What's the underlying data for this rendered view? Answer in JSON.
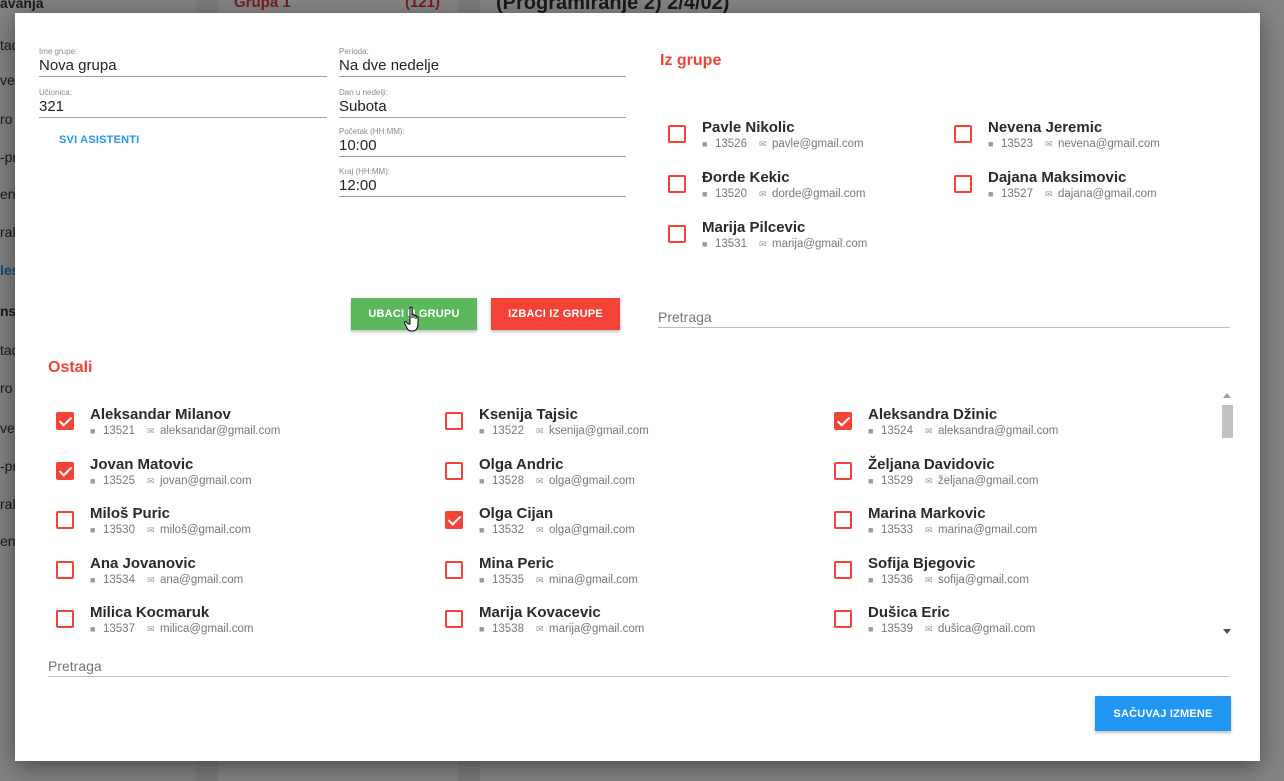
{
  "background": {
    "sidebar_items": [
      {
        "text": "avanja",
        "style": "bold"
      },
      {
        "text": "tad",
        "style": ""
      },
      {
        "text": "ve",
        "style": ""
      },
      {
        "text": "ro",
        "style": ""
      },
      {
        "text": "-pr",
        "style": ""
      },
      {
        "text": "en",
        "style": ""
      },
      {
        "text": "ral",
        "style": ""
      },
      {
        "text": "les",
        "style": "blue"
      },
      {
        "text": "ns",
        "style": "bold"
      },
      {
        "text": "tad",
        "style": ""
      },
      {
        "text": "ro",
        "style": ""
      },
      {
        "text": "ve",
        "style": ""
      },
      {
        "text": "-pr",
        "style": ""
      },
      {
        "text": "ral",
        "style": ""
      },
      {
        "text": "en",
        "style": ""
      }
    ],
    "group_name": "Grupa 1",
    "group_count": "(121)",
    "main_heading": "(Programiranje 2) 2/4/02)"
  },
  "form": {
    "group_name_label": "Ime grupe:",
    "group_name_value": "Nova grupa",
    "classroom_label": "Učionica:",
    "classroom_value": "321",
    "all_assistants_label": "SVI ASISTENTI",
    "period_label": "Perioda:",
    "period_value": "Na dve nedelje",
    "weekday_label": "Dan u nedelji:",
    "weekday_value": "Subota",
    "start_label": "Početak (HH:MM):",
    "start_value": "10:00",
    "end_label": "Kraj (HH:MM):",
    "end_value": "12:00"
  },
  "in_group": {
    "title": "Iz grupe",
    "search_placeholder": "Pretraga",
    "members": [
      {
        "name": "Pavle Nikolic",
        "id": "13526",
        "email": "pavle@gmail.com",
        "checked": false
      },
      {
        "name": "Nevena Jeremic",
        "id": "13523",
        "email": "nevena@gmail.com",
        "checked": false
      },
      {
        "name": "Đorde Kekic",
        "id": "13520",
        "email": "dorde@gmail.com",
        "checked": false
      },
      {
        "name": "Dajana Maksimovic",
        "id": "13527",
        "email": "dajana@gmail.com",
        "checked": false
      },
      {
        "name": "Marija Pilcevic",
        "id": "13531",
        "email": "marija@gmail.com",
        "checked": false
      }
    ]
  },
  "actions": {
    "add_label": "UBACI U GRUPU",
    "remove_label": "IZBACI IZ GRUPE",
    "save_label": "SAČUVAJ IZMENE"
  },
  "others": {
    "title": "Ostali",
    "search_placeholder": "Pretraga",
    "members": [
      {
        "name": "Aleksandar Milanov",
        "id": "13521",
        "email": "aleksandar@gmail.com",
        "checked": true
      },
      {
        "name": "Ksenija Tajsic",
        "id": "13522",
        "email": "ksenija@gmail.com",
        "checked": false
      },
      {
        "name": "Aleksandra Džinic",
        "id": "13524",
        "email": "aleksandra@gmail.com",
        "checked": true
      },
      {
        "name": "Jovan Matovic",
        "id": "13525",
        "email": "jovan@gmail.com",
        "checked": true
      },
      {
        "name": "Olga Andric",
        "id": "13528",
        "email": "olga@gmail.com",
        "checked": false
      },
      {
        "name": "Željana Davidovic",
        "id": "13529",
        "email": "željana@gmail.com",
        "checked": false
      },
      {
        "name": "Miloš Puric",
        "id": "13530",
        "email": "miloš@gmail.com",
        "checked": false
      },
      {
        "name": "Olga Cijan",
        "id": "13532",
        "email": "olga@gmail.com",
        "checked": true
      },
      {
        "name": "Marina Markovic",
        "id": "13533",
        "email": "marina@gmail.com",
        "checked": false
      },
      {
        "name": "Ana Jovanovic",
        "id": "13534",
        "email": "ana@gmail.com",
        "checked": false
      },
      {
        "name": "Mina Peric",
        "id": "13535",
        "email": "mina@gmail.com",
        "checked": false
      },
      {
        "name": "Sofija Bjegovic",
        "id": "13536",
        "email": "sofija@gmail.com",
        "checked": false
      },
      {
        "name": "Milica Kocmaruk",
        "id": "13537",
        "email": "milica@gmail.com",
        "checked": false
      },
      {
        "name": "Marija Kovacevic",
        "id": "13538",
        "email": "marija@gmail.com",
        "checked": false
      },
      {
        "name": "Dušica Eric",
        "id": "13539",
        "email": "dušica@gmail.com",
        "checked": false
      }
    ]
  },
  "colors": {
    "accent_red": "#f44336",
    "accent_green": "#5cb85c",
    "accent_blue": "#2196f3"
  },
  "icons": {
    "id": "book-icon",
    "email": "envelope-icon"
  }
}
